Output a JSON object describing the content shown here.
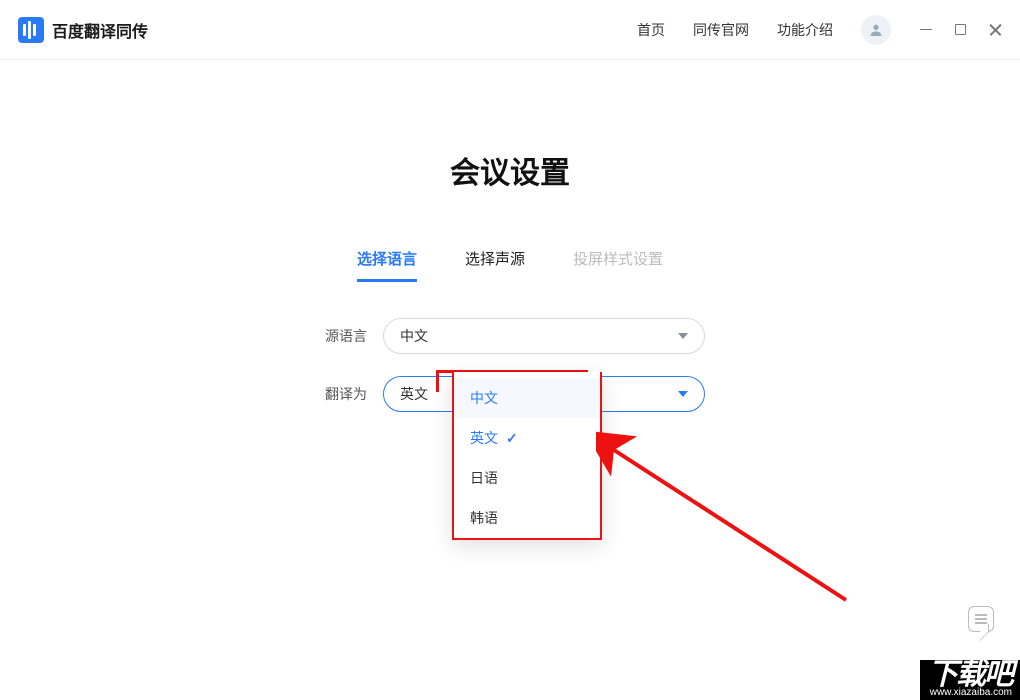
{
  "app": {
    "name": "百度翻译同传"
  },
  "nav": {
    "home": "首页",
    "official": "同传官网",
    "features": "功能介绍"
  },
  "page": {
    "title": "会议设置"
  },
  "tabs": {
    "lang": "选择语言",
    "audio": "选择声源",
    "layout": "投屏样式设置"
  },
  "form": {
    "source_label": "源语言",
    "target_label": "翻译为",
    "source_value": "中文",
    "target_value": "英文"
  },
  "target_options": {
    "zh": "中文",
    "en": "英文",
    "ja": "日语",
    "ko": "韩语"
  },
  "watermark": {
    "brand": "下载吧",
    "url": "www.xiazaiba.com"
  }
}
